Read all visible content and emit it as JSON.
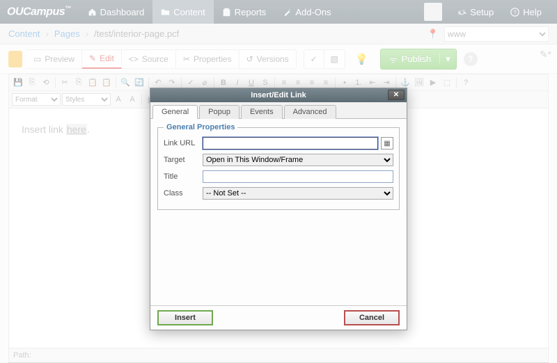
{
  "topnav": {
    "logo": "OUCampus",
    "items": [
      {
        "label": "Dashboard",
        "icon": "home"
      },
      {
        "label": "Content",
        "icon": "folder",
        "active": true
      },
      {
        "label": "Reports",
        "icon": "clipboard"
      },
      {
        "label": "Add-Ons",
        "icon": "wand"
      }
    ],
    "setup": "Setup",
    "help": "Help"
  },
  "breadcrumb": {
    "parts": [
      "Content",
      "Pages",
      "/test/interior-page.pcf"
    ],
    "site_selector": "www"
  },
  "actionbar": {
    "preview": "Preview",
    "edit": "Edit",
    "source": "Source",
    "properties": "Properties",
    "versions": "Versions",
    "publish": "Publish"
  },
  "toolbar": {
    "format_select": "Format",
    "styles_select": "Styles"
  },
  "editor": {
    "text_before": "Insert link ",
    "link_text": "here",
    "text_after": "."
  },
  "pathbar": {
    "label": "Path:"
  },
  "modal": {
    "title": "Insert/Edit Link",
    "tabs": [
      "General",
      "Popup",
      "Events",
      "Advanced"
    ],
    "legend": "General Properties",
    "fields": {
      "url_label": "Link URL",
      "url_value": "",
      "target_label": "Target",
      "target_value": "Open in This Window/Frame",
      "title_label": "Title",
      "title_value": "",
      "class_label": "Class",
      "class_value": "-- Not Set --"
    },
    "insert": "Insert",
    "cancel": "Cancel"
  }
}
